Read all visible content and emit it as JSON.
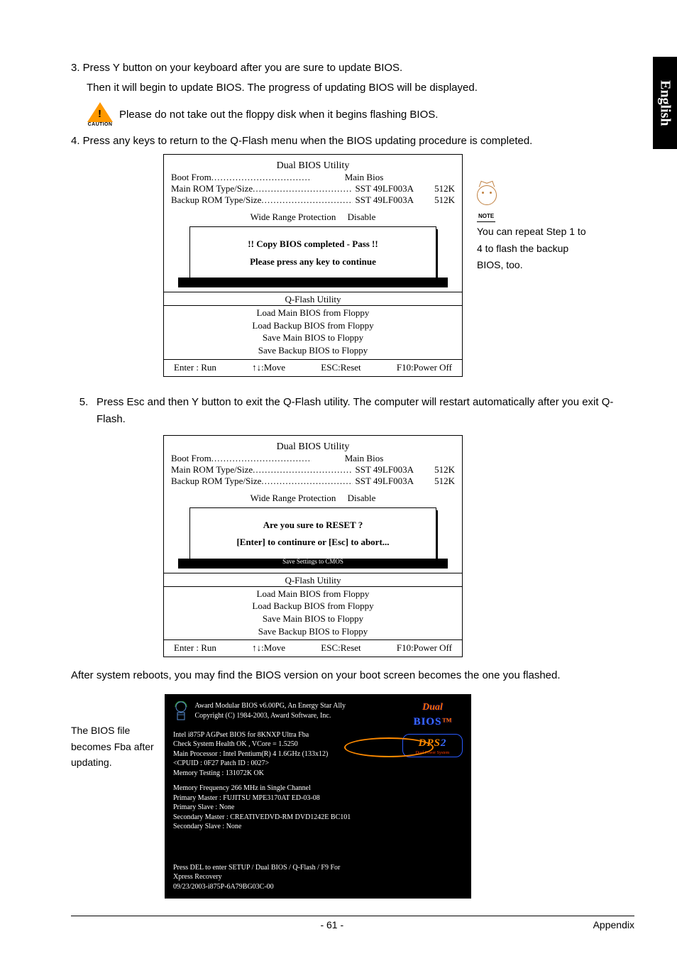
{
  "side_tab": "English",
  "steps": {
    "s3a": "3. Press Y button on your keyboard after you are sure to update BIOS.",
    "s3b": "Then it will begin to update BIOS. The progress of updating BIOS will be displayed.",
    "caution": "Please do not take out the floppy disk when it begins flashing BIOS.",
    "caution_label": "CAUTION",
    "s4": "4. Press any keys to return to the Q-Flash menu when the BIOS updating procedure is completed.",
    "s5": "Press Esc and then Y button to exit the Q-Flash utility. The computer will restart automatically after you exit Q-Flash.",
    "s5_num": "5.",
    "after_reboot": "After system reboots, you may find the BIOS version on your boot screen becomes the one you flashed.",
    "fba_note": "The BIOS file becomes Fba after updating."
  },
  "note": {
    "label": "NOTE",
    "text": "You can repeat Step 1 to 4 to flash the backup BIOS, too."
  },
  "bios1": {
    "title": "Dual BIOS Utility",
    "boot_from_label": "Boot From",
    "boot_from_val": "Main Bios",
    "main_rom_label": "Main ROM Type/Size",
    "main_rom_val": "SST 49LF003A",
    "main_rom_size": "512K",
    "backup_rom_label": "Backup ROM Type/Size",
    "backup_rom_val": "SST 49LF003A",
    "backup_rom_size": "512K",
    "wide_range": "Wide Range Protection",
    "wide_range_val": "Disable",
    "msg1": "!! Copy BIOS completed - Pass !!",
    "msg2": "Please press any key to continue",
    "sub_title": "Q-Flash Utility",
    "menu": [
      "Load Main BIOS from Floppy",
      "Load Backup BIOS from Floppy",
      "Save Main BIOS to Floppy",
      "Save Backup BIOS to Floppy"
    ],
    "footer": [
      "Enter : Run",
      "↑↓:Move",
      "ESC:Reset",
      "F10:Power Off"
    ]
  },
  "bios2": {
    "title": "Dual BIOS Utility",
    "boot_from_label": "Boot From",
    "boot_from_val": "Main Bios",
    "main_rom_label": "Main ROM Type/Size",
    "main_rom_val": "SST 49LF003A",
    "main_rom_size": "512K",
    "backup_rom_label": "Backup ROM Type/Size",
    "backup_rom_val": "SST 49LF003A",
    "backup_rom_size": "512K",
    "wide_range": "Wide Range Protection",
    "wide_range_val": "Disable",
    "msg1": "Are you sure to RESET ?",
    "msg2": "[Enter] to continure or [Esc] to abort...",
    "sub_title": "Q-Flash Utility",
    "menu": [
      "Load Main BIOS from Floppy",
      "Load Backup BIOS from Floppy",
      "Save Main BIOS to Floppy",
      "Save Backup BIOS to Floppy"
    ],
    "footer": [
      "Enter : Run",
      "↑↓:Move",
      "ESC:Reset",
      "F10:Power Off"
    ]
  },
  "boot": {
    "header1": "Award Modular BIOS v6.00PG, An Energy Star Ally",
    "header2": "Copyright  (C) 1984-2003, Award Software,  Inc.",
    "l1": "Intel i875P AGPset BIOS for 8KNXP Ultra Fba",
    "l2": "Check System Health OK , VCore = 1.5250",
    "l3": "Main Processor : Intel Pentium(R) 4  1.6GHz (133x12)",
    "l4": "<CPUID : 0F27 Patch ID  : 0027>",
    "l5": "Memory Testing  : 131072K OK",
    "l6": "Memory Frequency 266 MHz in Single Channel",
    "l7": "Primary Master : FUJITSU MPE3170AT ED-03-08",
    "l8": "Primary Slave : None",
    "l9": "Secondary Master : CREATIVEDVD-RM DVD1242E BC101",
    "l10": "Secondary Slave : None",
    "f1": "Press DEL to enter SETUP / Dual BIOS / Q-Flash / F9 For",
    "f2": "Xpress Recovery",
    "f3": "09/23/2003-i875P-6A79BG03C-00",
    "logo1a": "Dual",
    "logo1b": "BIOS",
    "logo2a": "DPS",
    "logo2b": "2",
    "logo2c": "Dual Power System"
  },
  "footer": {
    "page": "- 61 -",
    "section": "Appendix"
  }
}
